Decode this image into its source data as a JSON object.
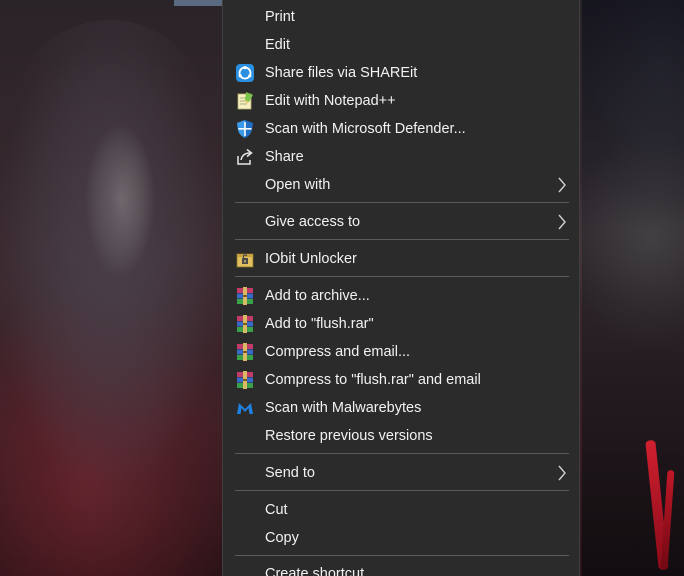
{
  "menu": {
    "items": [
      {
        "label": "Print",
        "icon": "none"
      },
      {
        "label": "Edit",
        "icon": "none"
      },
      {
        "label": "Share files via SHAREit",
        "icon": "shareit-icon"
      },
      {
        "label": "Edit with Notepad++",
        "icon": "notepad-plus-plus-icon"
      },
      {
        "label": "Scan with Microsoft Defender...",
        "icon": "microsoft-defender-icon"
      },
      {
        "label": "Share",
        "icon": "share-icon"
      },
      {
        "label": "Open with",
        "icon": "none",
        "submenu": true
      },
      {
        "label": "Give access to",
        "icon": "none",
        "submenu": true
      },
      {
        "label": "IObit Unlocker",
        "icon": "iobit-unlocker-icon"
      },
      {
        "label": "Add to archive...",
        "icon": "winrar-icon"
      },
      {
        "label": "Add to \"flush.rar\"",
        "icon": "winrar-icon"
      },
      {
        "label": "Compress and email...",
        "icon": "winrar-icon"
      },
      {
        "label": "Compress to \"flush.rar\" and email",
        "icon": "winrar-icon"
      },
      {
        "label": "Scan with Malwarebytes",
        "icon": "malwarebytes-icon"
      },
      {
        "label": "Restore previous versions",
        "icon": "none"
      },
      {
        "label": "Send to",
        "icon": "none",
        "submenu": true
      },
      {
        "label": "Cut",
        "icon": "none"
      },
      {
        "label": "Copy",
        "icon": "none"
      },
      {
        "label": "Create shortcut",
        "icon": "none"
      }
    ]
  },
  "colors": {
    "menu_background": "#2b2b2b",
    "menu_text": "#f2f2f2",
    "separator": "#5a5a5a"
  }
}
